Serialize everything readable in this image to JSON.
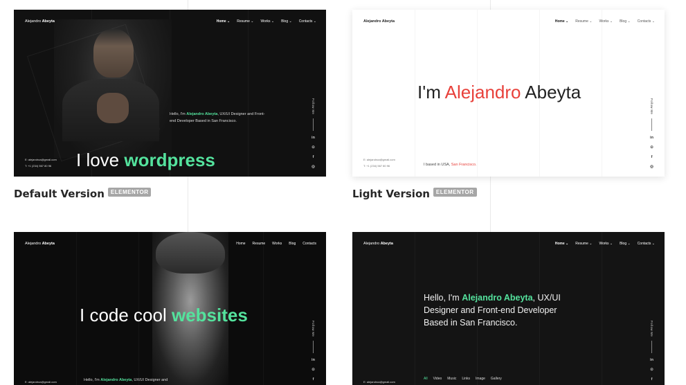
{
  "cards": {
    "default": {
      "brand_first": "Alejandro",
      "brand_last": "Abeyta",
      "nav": [
        "Home ⌄",
        "Resume ⌄",
        "Works ⌄",
        "Blog ⌄",
        "Contacts ⌄"
      ],
      "intro_prefix": "Hello, I'm ",
      "intro_name": "Alejandro Abeyta",
      "intro_suffix": ", UX/UI Designer and Front-end Developer Based in San Francisco.",
      "headline_plain": "I love ",
      "headline_accent": "wordpress",
      "email": "E: alejandroa@gmail.com",
      "phone": "T: +1 (234) 567 80 96",
      "follow": "Follow Me",
      "social": [
        "in",
        "⊙",
        "f",
        "◎"
      ]
    },
    "light": {
      "brand": "Alejandro Abeyta",
      "nav": [
        "Home ⌄",
        "Resume ⌄",
        "Works ⌄",
        "Blog ⌄",
        "Contacts ⌄"
      ],
      "headline_prefix": "I'm ",
      "headline_name": "Alejandro",
      "headline_suffix": " Abeyta",
      "based_prefix": "I based in USA, ",
      "based_city": "San Francisco.",
      "email": "E: alejandroa@gmail.com",
      "phone": "T: +1 (234) 567 80 96",
      "follow": "Follow Me",
      "social": [
        "in",
        "⊙",
        "f",
        "◎"
      ]
    },
    "code": {
      "brand_first": "Alejandro",
      "brand_last": "Abeyta",
      "nav": [
        "Home",
        "Resume",
        "Works",
        "Blog",
        "Contacts"
      ],
      "headline_plain": "I code cool ",
      "headline_accent": "websites",
      "intro_prefix": "Hello, I'm ",
      "intro_name": "Alejandro Abeyta",
      "intro_suffix": ", UX/UI Designer and",
      "email": "E: alejandroa@gmail.com",
      "follow": "Follow Me",
      "social": [
        "in",
        "⊙",
        "f"
      ]
    },
    "dark": {
      "brand_first": "Alejandro",
      "brand_last": "Abeyta",
      "nav": [
        "Home ⌄",
        "Resume ⌄",
        "Works ⌄",
        "Blog ⌄",
        "Contacts ⌄"
      ],
      "intro_prefix": "Hello, I'm ",
      "intro_name": "Alejandro Abeyta",
      "intro_line1_suffix": ", UX/UI",
      "intro_line2": "Designer and Front-end Developer",
      "intro_line3": "Based in San Francisco.",
      "email": "E: alejandroa@gmail.com",
      "filters": [
        "All",
        "Video",
        "Music",
        "Links",
        "Image",
        "Gallery"
      ],
      "follow": "Follow Me",
      "social": [
        "in",
        "⊙",
        "f"
      ]
    }
  },
  "captions": {
    "default_title": "Default Version",
    "default_badge": "ELEMENTOR",
    "light_title": "Light Version",
    "light_badge": "ELEMENTOR"
  },
  "colors": {
    "accent": "#54e29d",
    "red": "#e8413b",
    "dark_bg": "#111111",
    "badge": "#a6a6a6"
  }
}
